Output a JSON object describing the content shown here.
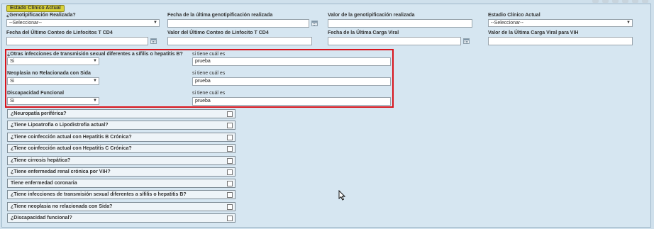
{
  "section": {
    "legend": "Estado Clínico Actual"
  },
  "row1": {
    "genotipificacion_label": "¿Genotipificación Realizada?",
    "genotipificacion_value": "--Seleccionar--",
    "fecha_genotip_label": "Fecha de la última genotipificación realizada",
    "valor_genotip_label": "Valor de la genotipificación realizada",
    "estadio_label": "Estadio Clínico Actual",
    "estadio_value": "--Seleccionar--"
  },
  "row2": {
    "fecha_cd4_label": "Fecha del Último Conteo de Linfocitos T CD4",
    "valor_cd4_label": "Valor del Último Conteo de Linfocito T CD4",
    "fecha_carga_label": "Fecha de la Última Carga Viral",
    "valor_carga_label": "Valor de la Última Carga Viral para VIH"
  },
  "highlighted": [
    {
      "question": "¿Otras infecciones de transmisión sexual diferentes a sífilis o hepatitis B?",
      "select_value": "Si",
      "detail_label": "si tiene cuál es",
      "detail_value": "prueba"
    },
    {
      "question": "Neoplasia no Relacionada con Sida",
      "select_value": "Si",
      "detail_label": "si tiene cuál es",
      "detail_value": "prueba"
    },
    {
      "question": "Discapacidad Funcional",
      "select_value": "Si",
      "detail_label": "si tiene cuál es",
      "detail_value": "prueba"
    }
  ],
  "checklist": [
    "¿Neuropatía periférica?",
    "¿Tiene Lipoatrofia o Lipodistrofia actual?",
    "¿Tiene coinfección actual con Hepatitis B Crónica?",
    "¿Tiene coinfección actual con Hepatitis C Crónica?",
    "¿Tiene cirrosis hepática?",
    "¿Tiene enfermedad renal crónica por VIH?",
    "Tiene enfermedad coronaria",
    "¿Tiene infecciones de transmisión sexual diferentes a sífilis o hepatitis B?",
    "¿Tiene neoplasia no relacionada con Sida?",
    "¿Discapacidad funcional?"
  ],
  "icons": {
    "dropdown": "chevron-down-icon",
    "calendar": "calendar-icon",
    "checkbox": "checkbox-icon",
    "cursor": "mouse-cursor-icon"
  }
}
